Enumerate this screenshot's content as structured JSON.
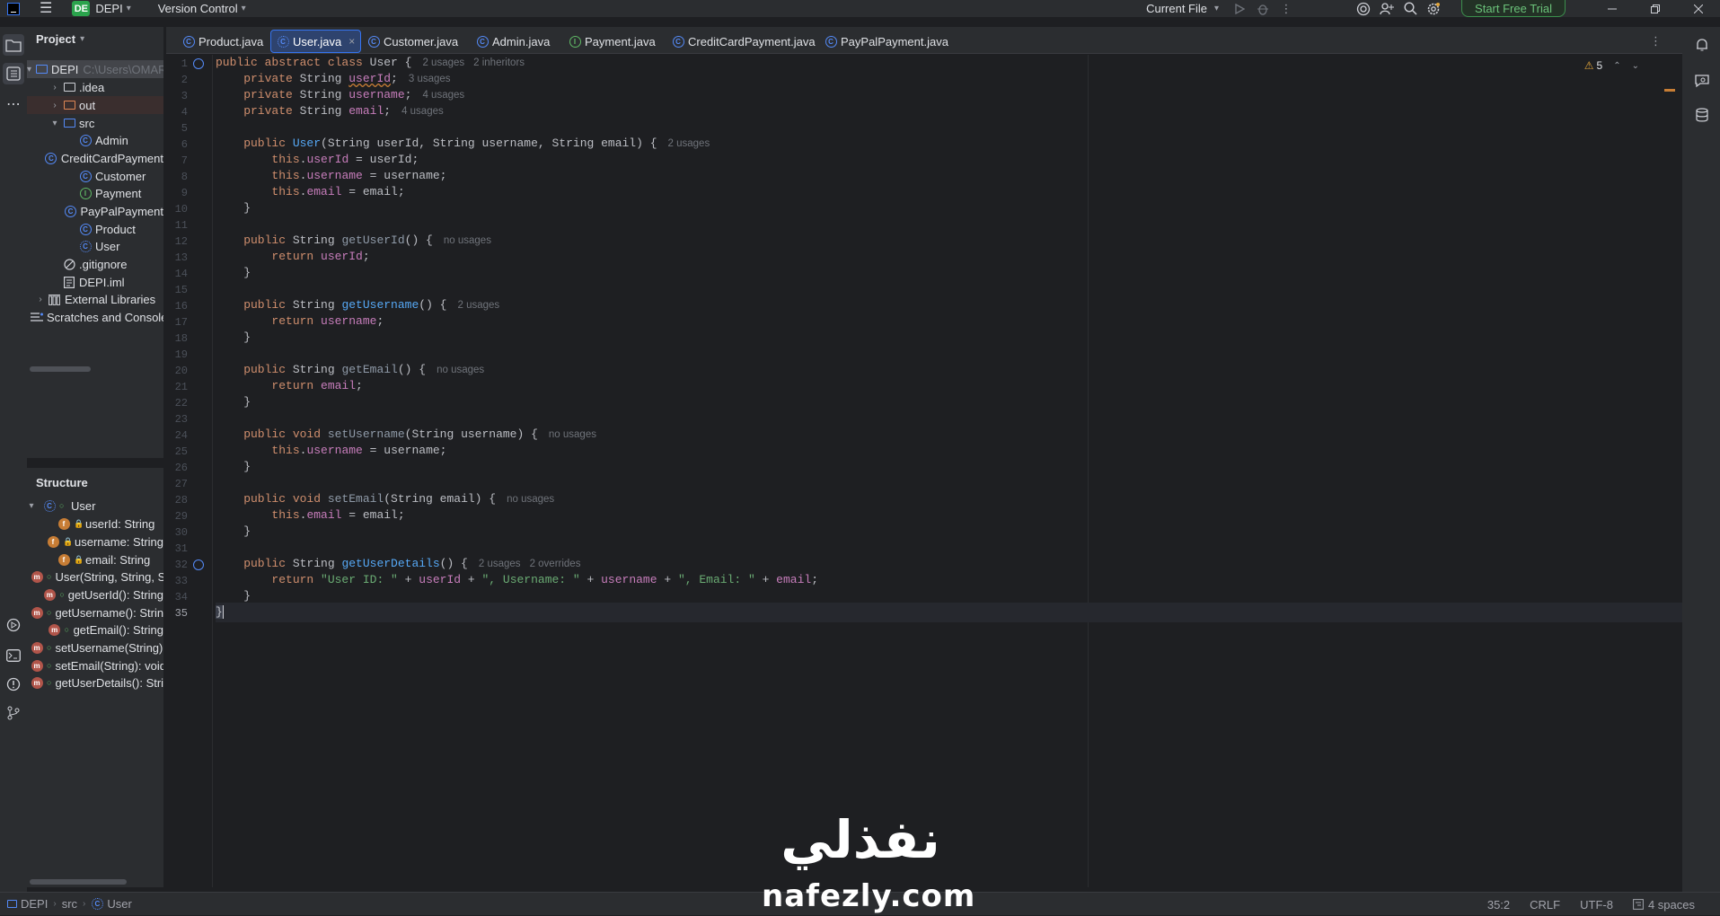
{
  "titlebar": {
    "project_badge": "DE",
    "project_name": "DEPI",
    "version_control": "Version Control",
    "current_file": "Current File",
    "trial_button": "Start Free Trial"
  },
  "project_panel": {
    "title": "Project",
    "root_name": "DEPI",
    "root_path": "C:\\Users\\OMAR",
    "items": [
      {
        "label": ".idea"
      },
      {
        "label": "out"
      },
      {
        "label": "src"
      },
      {
        "label": "Admin"
      },
      {
        "label": "CreditCardPayment"
      },
      {
        "label": "Customer"
      },
      {
        "label": "Payment"
      },
      {
        "label": "PayPalPayment"
      },
      {
        "label": "Product"
      },
      {
        "label": "User"
      },
      {
        "label": ".gitignore"
      },
      {
        "label": "DEPI.iml"
      },
      {
        "label": "External Libraries"
      },
      {
        "label": "Scratches and Consoles"
      }
    ]
  },
  "structure_panel": {
    "title": "Structure",
    "root": "User",
    "members": [
      "userId: String",
      "username: String",
      "email: String",
      "User(String, String, String)",
      "getUserId(): String",
      "getUsername(): String",
      "getEmail(): String",
      "setUsername(String): void",
      "setEmail(String): void",
      "getUserDetails(): String"
    ]
  },
  "tabs": [
    {
      "label": "Product.java"
    },
    {
      "label": "User.java"
    },
    {
      "label": "Customer.java"
    },
    {
      "label": "Admin.java"
    },
    {
      "label": "Payment.java"
    },
    {
      "label": "CreditCardPayment.java"
    },
    {
      "label": "PayPalPayment.java"
    }
  ],
  "inspection": {
    "warnings": "5"
  },
  "hints": {
    "class_usages": "2 usages",
    "class_inheritors": "2 inheritors",
    "userId_usages": "3 usages",
    "username_usages": "4 usages",
    "email_usages": "4 usages",
    "ctor_usages": "2 usages",
    "getUserId_usages": "no usages",
    "getUsername_usages": "2 usages",
    "getEmail_usages": "no usages",
    "setUsername_usages": "no usages",
    "setEmail_usages": "no usages",
    "getUserDetails_usages": "2 usages",
    "getUserDetails_overrides": "2 overrides"
  },
  "code": {
    "s_id": "\"User ID: \"",
    "s_un": "\", Username: \"",
    "s_em": "\", Email: \""
  },
  "line_numbers": [
    "1",
    "2",
    "3",
    "4",
    "5",
    "6",
    "7",
    "8",
    "9",
    "10",
    "11",
    "12",
    "13",
    "14",
    "15",
    "16",
    "17",
    "18",
    "19",
    "20",
    "21",
    "22",
    "23",
    "24",
    "25",
    "26",
    "27",
    "28",
    "29",
    "30",
    "31",
    "32",
    "33",
    "34",
    "35"
  ],
  "statusbar": {
    "crumb_project": "DEPI",
    "crumb_src": "src",
    "crumb_class": "User",
    "position": "35:2",
    "line_ending": "CRLF",
    "encoding": "UTF-8",
    "indent": "4 spaces"
  },
  "watermark": {
    "arabic": "نفذلي",
    "latin": "nafezly.com"
  }
}
